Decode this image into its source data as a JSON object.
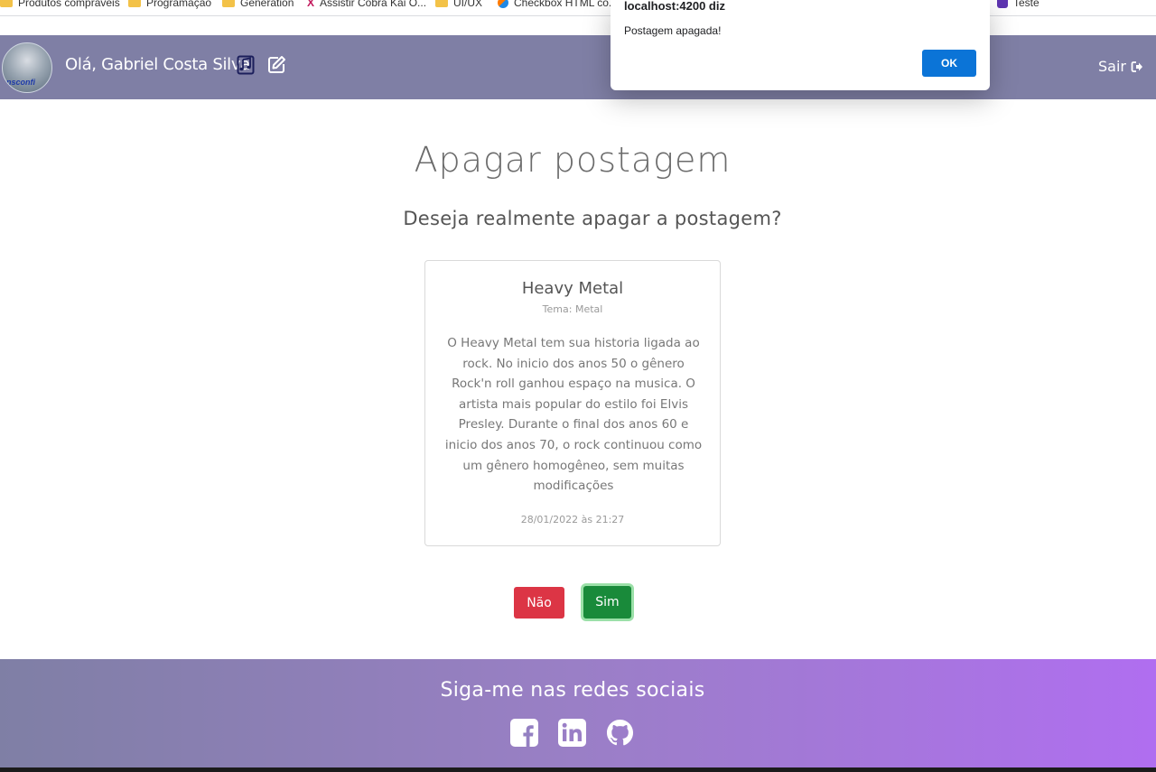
{
  "bookmarks": [
    {
      "label": "Produtos compráveis",
      "icon": "folder-icon"
    },
    {
      "label": "Programação",
      "icon": "folder-icon"
    },
    {
      "label": "Generation",
      "icon": "folder-icon"
    },
    {
      "label": "Assistir Cobra Kai O...",
      "icon": "x-icon"
    },
    {
      "label": "UI/UX",
      "icon": "folder-icon"
    },
    {
      "label": "Checkbox HTML co...",
      "icon": "checkbox-site-icon"
    },
    {
      "label": "Teste",
      "icon": "purple-app-icon"
    }
  ],
  "navbar": {
    "greeting": "Olá, Gabriel Costa Silva",
    "logout_label": "Sair",
    "avatar_tag": "nsconfi"
  },
  "dialog": {
    "origin": "localhost:4200 diz",
    "message": "Postagem apagada!",
    "ok_label": "OK"
  },
  "main": {
    "title": "Apagar postagem",
    "question": "Deseja realmente apagar a postagem?"
  },
  "post": {
    "title": "Heavy Metal",
    "theme": "Tema: Metal",
    "text": "O Heavy Metal tem sua historia ligada ao rock. No inicio dos anos 50 o gênero Rock'n roll ganhou espaço na musica. O artista mais popular do estilo foi Elvis Presley. Durante o final dos anos 60 e inicio dos anos 70, o rock continuou como um gênero homogêneo, sem muitas modificações",
    "date": "28/01/2022 às 21:27"
  },
  "actions": {
    "no_label": "Não",
    "yes_label": "Sim"
  },
  "footer": {
    "title": "Siga-me nas redes sociais",
    "icons": [
      "facebook-icon",
      "linkedin-icon",
      "github-icon"
    ]
  },
  "colors": {
    "navbar": "#7f7fa5",
    "danger": "#dc3545",
    "success": "#198a3a",
    "dialog_ok": "#0b74d7",
    "footer_end": "#b06ef0"
  }
}
